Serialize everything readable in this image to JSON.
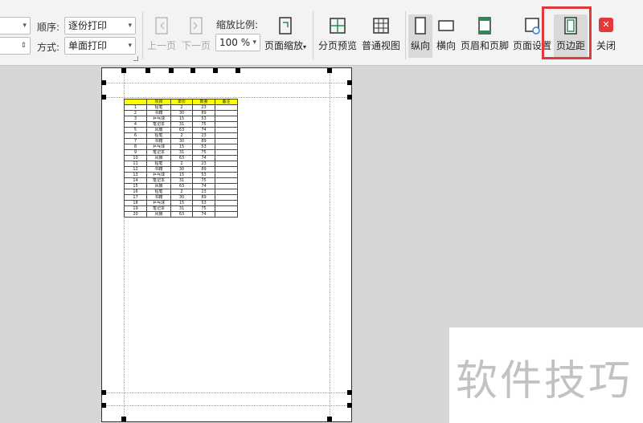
{
  "toolbar": {
    "order_label": "顺序:",
    "order_value": "逐份打印",
    "mode_label": "方式:",
    "mode_value": "单面打印",
    "prev_page": "上一页",
    "next_page": "下一页",
    "zoom_label": "缩放比例:",
    "zoom_value": "100 %",
    "page_zoom": "页面缩放",
    "page_break_preview": "分页预览",
    "normal_view": "普通视图",
    "portrait": "纵向",
    "landscape": "横向",
    "header_footer": "页眉和页脚",
    "page_setup": "页面设置",
    "margins": "页边距",
    "close": "关闭",
    "highlight_color": "#e23a3a"
  },
  "sheet": {
    "headers": [
      "项目",
      "单价",
      "数量",
      "备注"
    ],
    "rows": [
      [
        "1",
        "铅笔",
        "2",
        "23",
        ""
      ],
      [
        "2",
        "书籍",
        "30",
        "89",
        ""
      ],
      [
        "3",
        "乒乓球",
        "15",
        "53",
        ""
      ],
      [
        "4",
        "笔记本",
        "31",
        "75",
        ""
      ],
      [
        "5",
        "风扇",
        "63",
        "74",
        ""
      ],
      [
        "6",
        "铅笔",
        "2",
        "23",
        ""
      ],
      [
        "7",
        "书籍",
        "30",
        "89",
        ""
      ],
      [
        "8",
        "乒乓球",
        "15",
        "53",
        ""
      ],
      [
        "9",
        "笔记本",
        "31",
        "75",
        ""
      ],
      [
        "10",
        "风扇",
        "63",
        "74",
        ""
      ],
      [
        "11",
        "铅笔",
        "2",
        "23",
        ""
      ],
      [
        "12",
        "书籍",
        "30",
        "89",
        ""
      ],
      [
        "13",
        "乒乓球",
        "15",
        "53",
        ""
      ],
      [
        "14",
        "笔记本",
        "31",
        "75",
        ""
      ],
      [
        "15",
        "风扇",
        "63",
        "74",
        ""
      ],
      [
        "16",
        "铅笔",
        "2",
        "23",
        ""
      ],
      [
        "17",
        "书籍",
        "30",
        "89",
        ""
      ],
      [
        "18",
        "乒乓球",
        "15",
        "53",
        ""
      ],
      [
        "19",
        "笔记本",
        "31",
        "75",
        ""
      ],
      [
        "20",
        "风扇",
        "63",
        "74",
        ""
      ]
    ]
  },
  "watermark": "软件技巧"
}
